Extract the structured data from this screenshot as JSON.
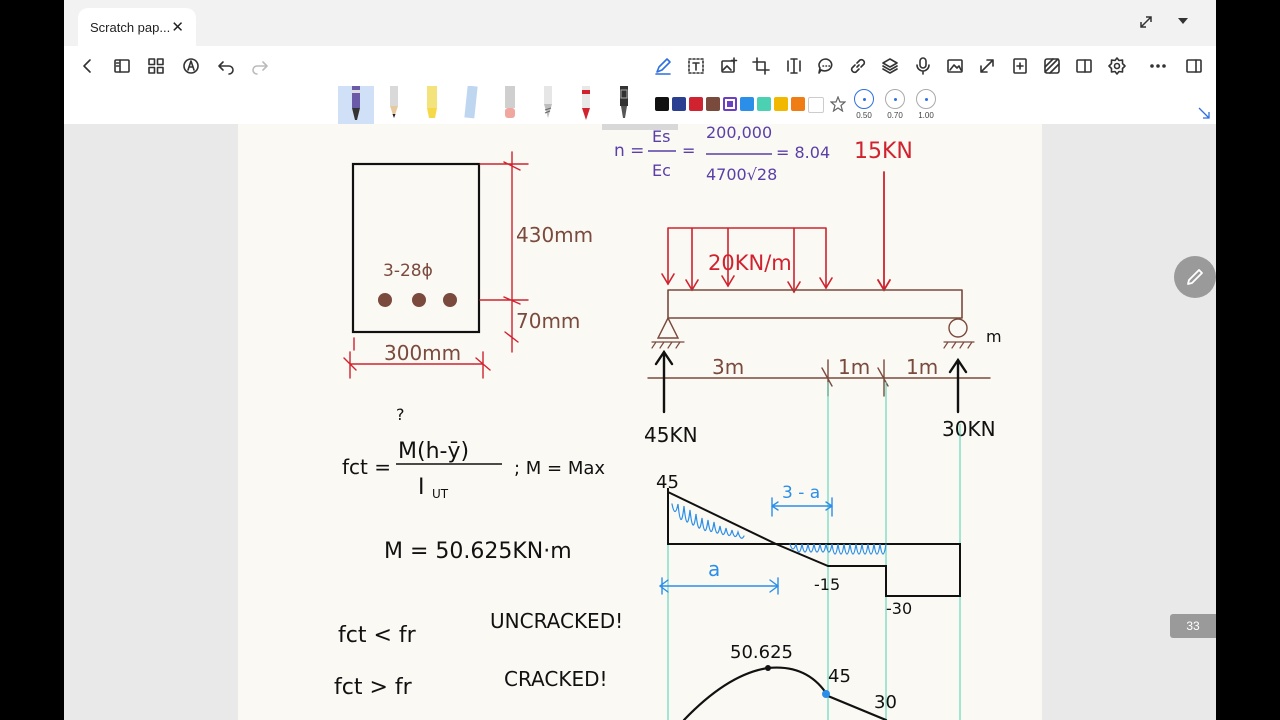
{
  "tab": {
    "title": "Scratch pap...",
    "close_icon": "close-icon"
  },
  "window": {
    "expand_icon": "expand-icon",
    "dropdown_icon": "chevron-down-icon"
  },
  "toolbar": {
    "left_icons": [
      "back-icon",
      "sidebar-icon",
      "grid-icon",
      "pen-mode-icon",
      "undo-icon",
      "redo-icon"
    ],
    "right_icons": [
      "pen-tool-icon",
      "text-box-icon",
      "add-image-icon",
      "crop-icon",
      "text-cursor-icon",
      "comment-icon",
      "link-icon",
      "layers-icon",
      "microphone-icon",
      "image-icon",
      "expand-arrow-icon",
      "add-page-icon",
      "pattern-icon",
      "split-view-icon",
      "settings-icon",
      "more-icon",
      "panel-icon"
    ]
  },
  "pens": [
    "fountain-pen",
    "pencil",
    "highlighter",
    "ruler",
    "eraser",
    "lasso",
    "red-pen",
    "mechanical-pen"
  ],
  "colors": [
    "#111111",
    "#2a3f8f",
    "#d0222f",
    "#7a4a3d",
    "#6a3fc4",
    "#2b8ee8",
    "#4bd1b1",
    "#f2b800",
    "#f07d14",
    "#ffffff"
  ],
  "thickness": [
    "0.50",
    "0.70",
    "1.00"
  ],
  "notes": {
    "modular_ratio": {
      "n": "n =",
      "es": "Es",
      "ec": "Ec",
      "num": "200,000",
      "den": "4700√28",
      "result": "= 8.04"
    },
    "section": {
      "height": "430mm",
      "cover": "70mm",
      "width": "300mm",
      "bars": "3-28ϕ"
    },
    "point_load": "15KN",
    "udl": "20KN/m",
    "spans": [
      "3m",
      "1m",
      "1m"
    ],
    "reactions": [
      "45KN",
      "30KN"
    ],
    "support_label": "m",
    "fct_formula": {
      "lhs": "fct =",
      "num": "M(h-ȳ)",
      "q": "?",
      "den": "I",
      "den_sub": "UT",
      "note": "; M = Max"
    },
    "moment": "M = 50.625KN·m",
    "conditions": [
      {
        "lhs": "fct < fr",
        "result": "UNCRACKED!"
      },
      {
        "lhs": "fct > fr",
        "result": "CRACKED!"
      }
    ],
    "shear": {
      "v1": "45",
      "v2": "-15",
      "v3": "-30",
      "a": "a",
      "three_minus_a": "3 - a"
    },
    "bmd": {
      "max": "50.625",
      "m1": "45",
      "m2": "30"
    }
  },
  "page_number": "33"
}
